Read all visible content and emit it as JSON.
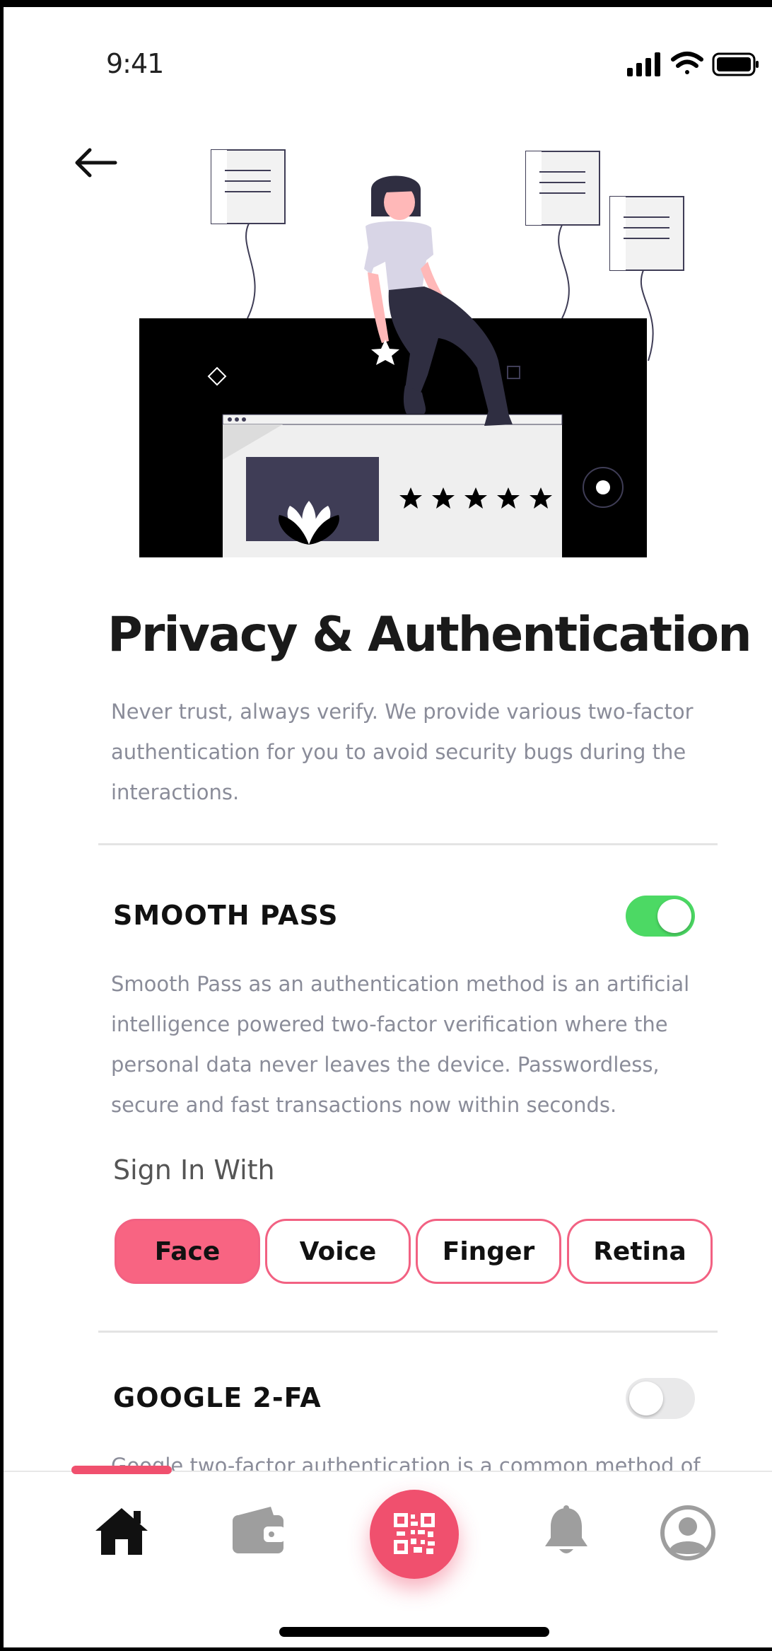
{
  "status_bar": {
    "time": "9:41"
  },
  "page": {
    "title": "Privacy & Authentication",
    "intro": "Never trust, always verify. We provide various two-factor authentication for you to avoid security bugs during the interactions."
  },
  "smooth_pass": {
    "title": "SMOOTH PASS",
    "enabled": true,
    "description": "Smooth Pass as an authentication method is an artificial intelligence powered two-factor verification where the personal data never leaves the device. Passwordless, secure and fast transactions now within seconds.",
    "sign_in_label": "Sign In With",
    "methods": [
      "Face",
      "Voice",
      "Finger",
      "Retina"
    ],
    "selected_method": "Face"
  },
  "google_2fa": {
    "title": "GOOGLE 2-FA",
    "enabled": false,
    "description": "Google two-factor authentication is a common method of"
  },
  "tab_bar": {
    "items": [
      "home-icon",
      "wallet-icon",
      "qr-code-icon",
      "bell-icon",
      "profile-icon"
    ],
    "active": "home-icon"
  },
  "colors": {
    "accent": "#f0506e",
    "toggle_on": "#4cd964",
    "toggle_off": "#e9e9ea",
    "text_muted": "#8a8c99"
  }
}
